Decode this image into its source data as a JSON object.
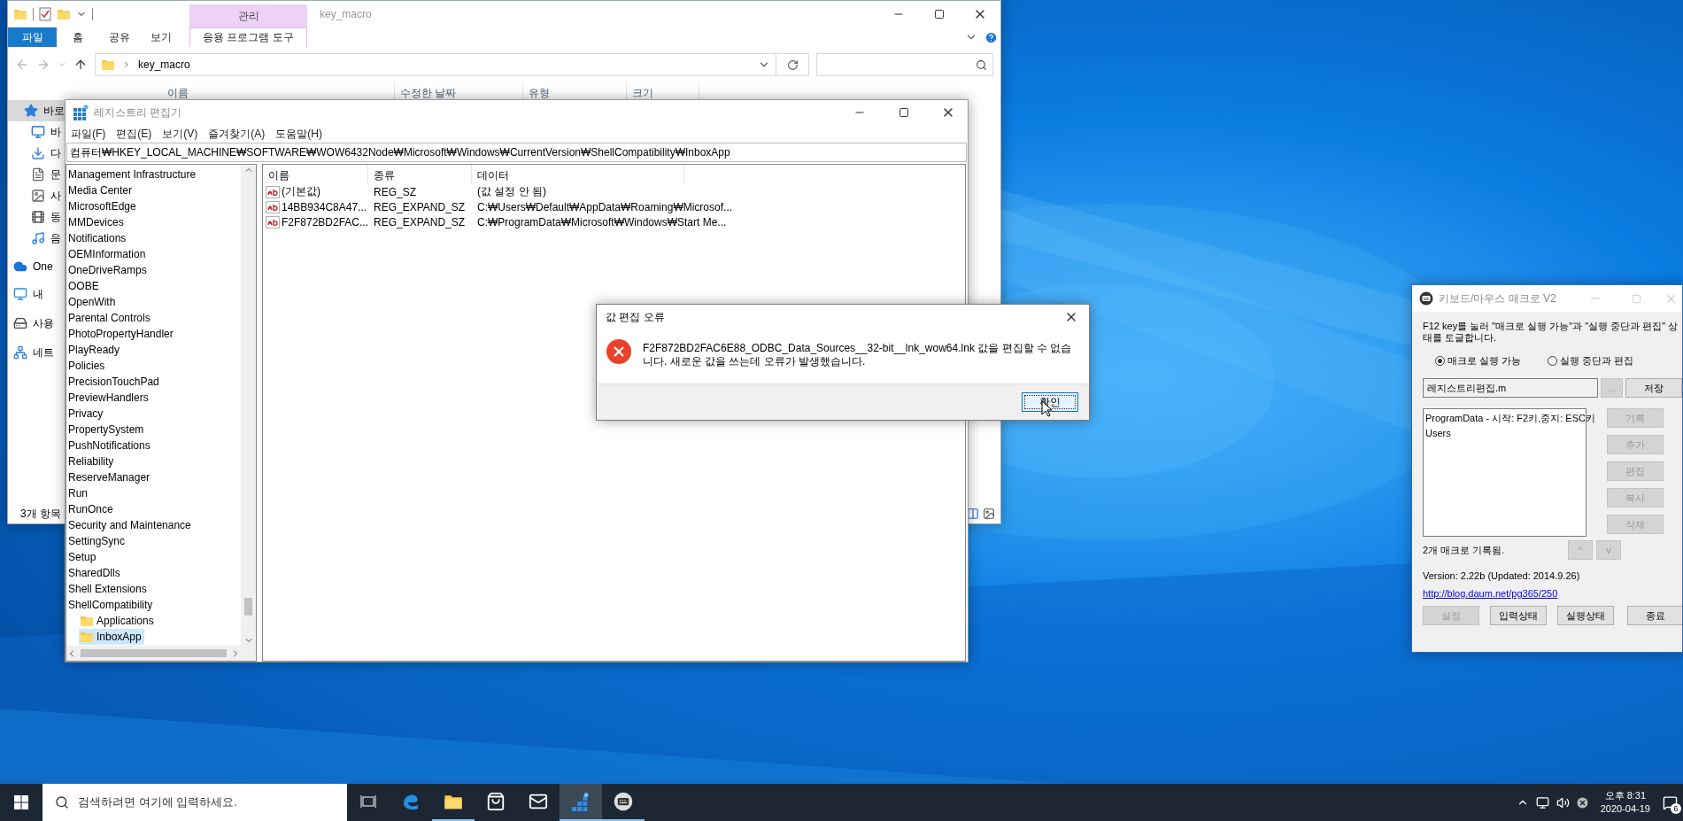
{
  "explorer": {
    "title": "key_macro",
    "context_group": "관리",
    "ribbon_tabs": [
      {
        "label": "파일",
        "kind": "file"
      },
      {
        "label": "홈",
        "kind": "plain"
      },
      {
        "label": "공유",
        "kind": "plain"
      },
      {
        "label": "보기",
        "kind": "plain"
      },
      {
        "label": "응용 프로그램 도구",
        "kind": "context"
      }
    ],
    "address": "key_macro",
    "columns": [
      "이름",
      "수정한 날짜",
      "유형",
      "크기"
    ],
    "nav": [
      {
        "label": "바로",
        "selected": true
      },
      {
        "label": "바",
        "selected": false
      },
      {
        "label": "다",
        "selected": false
      },
      {
        "label": "문",
        "selected": false
      },
      {
        "label": "사",
        "selected": false
      },
      {
        "label": "동",
        "selected": false
      },
      {
        "label": "음",
        "selected": false
      },
      {
        "label": "One",
        "selected": false
      },
      {
        "label": "내",
        "selected": false
      },
      {
        "label": "사용",
        "selected": false
      },
      {
        "label": "네트",
        "selected": false
      }
    ],
    "status": "3개 항목"
  },
  "registry": {
    "title": "레지스트리 편집기",
    "menu": [
      "파일(F)",
      "편집(E)",
      "보기(V)",
      "즐겨찾기(A)",
      "도움말(H)"
    ],
    "path": "컴퓨터₩HKEY_LOCAL_MACHINE₩SOFTWARE₩WOW6432Node₩Microsoft₩Windows₩CurrentVersion₩ShellCompatibility₩InboxApp",
    "tree": [
      {
        "label": "Management Infrastructure",
        "selected": false
      },
      {
        "label": "Media Center",
        "selected": false
      },
      {
        "label": "MicrosoftEdge",
        "selected": false
      },
      {
        "label": "MMDevices",
        "selected": false
      },
      {
        "label": "Notifications",
        "selected": false
      },
      {
        "label": "OEMInformation",
        "selected": false
      },
      {
        "label": "OneDriveRamps",
        "selected": false
      },
      {
        "label": "OOBE",
        "selected": false
      },
      {
        "label": "OpenWith",
        "selected": false
      },
      {
        "label": "Parental Controls",
        "selected": false
      },
      {
        "label": "PhotoPropertyHandler",
        "selected": false
      },
      {
        "label": "PlayReady",
        "selected": false
      },
      {
        "label": "Policies",
        "selected": false
      },
      {
        "label": "PrecisionTouchPad",
        "selected": false
      },
      {
        "label": "PreviewHandlers",
        "selected": false
      },
      {
        "label": "Privacy",
        "selected": false
      },
      {
        "label": "PropertySystem",
        "selected": false
      },
      {
        "label": "PushNotifications",
        "selected": false
      },
      {
        "label": "Reliability",
        "selected": false
      },
      {
        "label": "ReserveManager",
        "selected": false
      },
      {
        "label": "Run",
        "selected": false
      },
      {
        "label": "RunOnce",
        "selected": false
      },
      {
        "label": "Security and Maintenance",
        "selected": false
      },
      {
        "label": "SettingSync",
        "selected": false
      },
      {
        "label": "Setup",
        "selected": false
      },
      {
        "label": "SharedDlls",
        "selected": false
      },
      {
        "label": "Shell Extensions",
        "selected": false
      },
      {
        "label": "ShellCompatibility",
        "selected": false,
        "children": [
          {
            "label": "Applications",
            "selected": false
          },
          {
            "label": "InboxApp",
            "selected": true
          }
        ]
      }
    ],
    "columns": [
      "이름",
      "종류",
      "데이터"
    ],
    "values": [
      {
        "name": "(기본값)",
        "type": "REG_SZ",
        "data": "(값 설정 안 됨)"
      },
      {
        "name": "14BB934C8A47...",
        "type": "REG_EXPAND_SZ",
        "data": "C:₩Users₩Default₩AppData₩Roaming₩Microsof..."
      },
      {
        "name": "F2F872BD2FAC...",
        "type": "REG_EXPAND_SZ",
        "data": "C:₩ProgramData₩Microsoft₩Windows₩Start Me..."
      }
    ]
  },
  "dialog": {
    "title": "값 편집 오류",
    "message": "F2F872BD2FAC6E88_ODBC_Data_Sources__32-bit__lnk_wow64.lnk 값을 편집할 수 없습니다. 새로운 값을 쓰는데 오류가 발생했습니다.",
    "button": "확인"
  },
  "macro": {
    "title": "키보드/마우스 매크로 V2",
    "description": "F12 key를 눌러 \"매크로 실행 가능\"과 \"실행 중단과 편집\" 상태를 토글합니다.",
    "radios": [
      {
        "label": "매크로 실행 가능",
        "selected": true
      },
      {
        "label": "실행 중단과 편집",
        "selected": false
      }
    ],
    "file": "레지스트리편집.m",
    "browse": {
      "label": "...",
      "disabled": true
    },
    "save": {
      "label": "저장",
      "disabled": false
    },
    "macros": [
      "ProgramData - 시작: F2키,중지: ESC키",
      "Users"
    ],
    "side_buttons": [
      {
        "label": "기록",
        "disabled": true
      },
      {
        "label": "추가",
        "disabled": true
      },
      {
        "label": "편집",
        "disabled": true
      },
      {
        "label": "복사",
        "disabled": true
      },
      {
        "label": "삭제",
        "disabled": true
      }
    ],
    "count": "2개 매크로 기록됨.",
    "move_buttons": [
      {
        "label": "^",
        "disabled": true
      },
      {
        "label": "v",
        "disabled": true
      }
    ],
    "version": "Version: 2.22b (Updated: 2014.9.26)",
    "link": "http://blog.daum.net/pg365/250",
    "bottom_buttons": [
      {
        "label": "설정",
        "disabled": true
      },
      {
        "label": "입력상태",
        "disabled": false
      },
      {
        "label": "실행상태",
        "disabled": false
      },
      {
        "label": "종료",
        "disabled": false
      }
    ]
  },
  "taskbar": {
    "search_placeholder": "검색하려면 여기에 입력하세요.",
    "apps": [
      {
        "open": false,
        "selected": false
      },
      {
        "open": false,
        "selected": false
      },
      {
        "open": true,
        "selected": false
      },
      {
        "open": false,
        "selected": false
      },
      {
        "open": false,
        "selected": false
      },
      {
        "open": true,
        "selected": true
      },
      {
        "open": true,
        "selected": false
      }
    ],
    "time": "오후 8:31",
    "date": "2020-04-19",
    "notifications": "6"
  }
}
